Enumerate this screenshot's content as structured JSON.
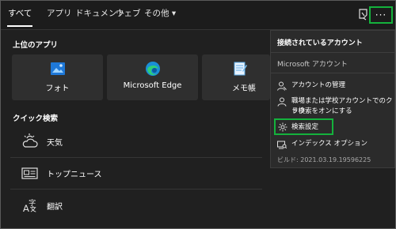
{
  "tabs": [
    {
      "label": "すべて"
    },
    {
      "label": "アプリ"
    },
    {
      "label": "ドキュメント"
    },
    {
      "label": "ウェブ"
    },
    {
      "label": "その他 ▾"
    }
  ],
  "more_label": "···",
  "top_apps": {
    "heading": "上位のアプリ",
    "items": [
      {
        "label": "フォト",
        "icon": "photos-icon"
      },
      {
        "label": "Microsoft Edge",
        "icon": "edge-icon"
      },
      {
        "label": "メモ帳",
        "icon": "notepad-icon"
      }
    ]
  },
  "quick_search": {
    "heading": "クイック検索",
    "items": [
      {
        "label": "天気",
        "icon": "weather-icon"
      },
      {
        "label": "トップニュース",
        "icon": "news-icon"
      },
      {
        "label": "翻訳",
        "icon": "translate-icon"
      }
    ]
  },
  "menu": {
    "title": "接続されているアカウント",
    "account": "Microsoft アカウント",
    "items": [
      {
        "label": "アカウントの管理",
        "icon": "account-manage-icon"
      },
      {
        "label": "職場または学校アカウントでのクラウド検索をオンにする",
        "line1": "職場または学校アカウントでのクラウ",
        "line2": "ド検索をオンにする",
        "icon": "person-icon"
      },
      {
        "label": "検索設定",
        "icon": "gear-icon"
      },
      {
        "label": "インデックス オプション",
        "icon": "index-icon"
      }
    ],
    "build": "ビルド: 2021.03.19.19596225"
  },
  "colors": {
    "highlight": "#14b23c",
    "background": "#202020",
    "tile": "#2f2f2f"
  }
}
